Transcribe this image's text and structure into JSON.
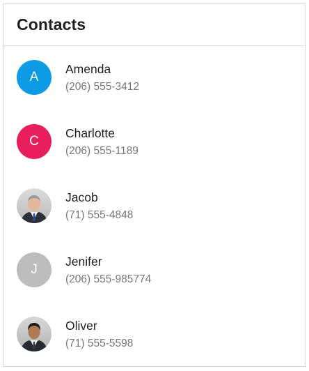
{
  "header": {
    "title": "Contacts"
  },
  "contacts": [
    {
      "name": "Amenda",
      "phone": "(206) 555-3412",
      "avatar": {
        "type": "initial",
        "initial": "A",
        "color": "#0d9be5"
      }
    },
    {
      "name": "Charlotte",
      "phone": "(206) 555-1189",
      "avatar": {
        "type": "initial",
        "initial": "C",
        "color": "#e91e5f"
      }
    },
    {
      "name": "Jacob",
      "phone": "(71) 555-4848",
      "avatar": {
        "type": "photo",
        "icon": "person-photo-icon"
      }
    },
    {
      "name": "Jenifer",
      "phone": "(206) 555-985774",
      "avatar": {
        "type": "initial",
        "initial": "J",
        "color": "#bdbdbd"
      }
    },
    {
      "name": "Oliver",
      "phone": "(71) 555-5598",
      "avatar": {
        "type": "photo",
        "icon": "person-photo-icon"
      }
    }
  ]
}
